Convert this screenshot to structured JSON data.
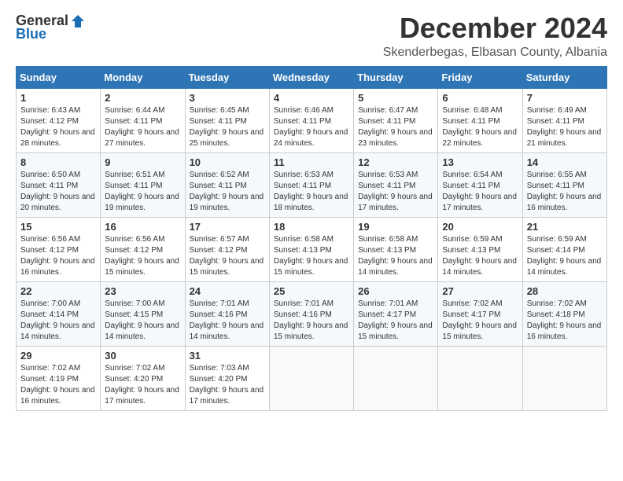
{
  "header": {
    "logo_general": "General",
    "logo_blue": "Blue",
    "title": "December 2024",
    "subtitle": "Skenderbegas, Elbasan County, Albania"
  },
  "days_of_week": [
    "Sunday",
    "Monday",
    "Tuesday",
    "Wednesday",
    "Thursday",
    "Friday",
    "Saturday"
  ],
  "weeks": [
    [
      {
        "day": "1",
        "sunrise": "6:43 AM",
        "sunset": "4:12 PM",
        "daylight": "9 hours and 28 minutes."
      },
      {
        "day": "2",
        "sunrise": "6:44 AM",
        "sunset": "4:11 PM",
        "daylight": "9 hours and 27 minutes."
      },
      {
        "day": "3",
        "sunrise": "6:45 AM",
        "sunset": "4:11 PM",
        "daylight": "9 hours and 25 minutes."
      },
      {
        "day": "4",
        "sunrise": "6:46 AM",
        "sunset": "4:11 PM",
        "daylight": "9 hours and 24 minutes."
      },
      {
        "day": "5",
        "sunrise": "6:47 AM",
        "sunset": "4:11 PM",
        "daylight": "9 hours and 23 minutes."
      },
      {
        "day": "6",
        "sunrise": "6:48 AM",
        "sunset": "4:11 PM",
        "daylight": "9 hours and 22 minutes."
      },
      {
        "day": "7",
        "sunrise": "6:49 AM",
        "sunset": "4:11 PM",
        "daylight": "9 hours and 21 minutes."
      }
    ],
    [
      {
        "day": "8",
        "sunrise": "6:50 AM",
        "sunset": "4:11 PM",
        "daylight": "9 hours and 20 minutes."
      },
      {
        "day": "9",
        "sunrise": "6:51 AM",
        "sunset": "4:11 PM",
        "daylight": "9 hours and 19 minutes."
      },
      {
        "day": "10",
        "sunrise": "6:52 AM",
        "sunset": "4:11 PM",
        "daylight": "9 hours and 19 minutes."
      },
      {
        "day": "11",
        "sunrise": "6:53 AM",
        "sunset": "4:11 PM",
        "daylight": "9 hours and 18 minutes."
      },
      {
        "day": "12",
        "sunrise": "6:53 AM",
        "sunset": "4:11 PM",
        "daylight": "9 hours and 17 minutes."
      },
      {
        "day": "13",
        "sunrise": "6:54 AM",
        "sunset": "4:11 PM",
        "daylight": "9 hours and 17 minutes."
      },
      {
        "day": "14",
        "sunrise": "6:55 AM",
        "sunset": "4:11 PM",
        "daylight": "9 hours and 16 minutes."
      }
    ],
    [
      {
        "day": "15",
        "sunrise": "6:56 AM",
        "sunset": "4:12 PM",
        "daylight": "9 hours and 16 minutes."
      },
      {
        "day": "16",
        "sunrise": "6:56 AM",
        "sunset": "4:12 PM",
        "daylight": "9 hours and 15 minutes."
      },
      {
        "day": "17",
        "sunrise": "6:57 AM",
        "sunset": "4:12 PM",
        "daylight": "9 hours and 15 minutes."
      },
      {
        "day": "18",
        "sunrise": "6:58 AM",
        "sunset": "4:13 PM",
        "daylight": "9 hours and 15 minutes."
      },
      {
        "day": "19",
        "sunrise": "6:58 AM",
        "sunset": "4:13 PM",
        "daylight": "9 hours and 14 minutes."
      },
      {
        "day": "20",
        "sunrise": "6:59 AM",
        "sunset": "4:13 PM",
        "daylight": "9 hours and 14 minutes."
      },
      {
        "day": "21",
        "sunrise": "6:59 AM",
        "sunset": "4:14 PM",
        "daylight": "9 hours and 14 minutes."
      }
    ],
    [
      {
        "day": "22",
        "sunrise": "7:00 AM",
        "sunset": "4:14 PM",
        "daylight": "9 hours and 14 minutes."
      },
      {
        "day": "23",
        "sunrise": "7:00 AM",
        "sunset": "4:15 PM",
        "daylight": "9 hours and 14 minutes."
      },
      {
        "day": "24",
        "sunrise": "7:01 AM",
        "sunset": "4:16 PM",
        "daylight": "9 hours and 14 minutes."
      },
      {
        "day": "25",
        "sunrise": "7:01 AM",
        "sunset": "4:16 PM",
        "daylight": "9 hours and 15 minutes."
      },
      {
        "day": "26",
        "sunrise": "7:01 AM",
        "sunset": "4:17 PM",
        "daylight": "9 hours and 15 minutes."
      },
      {
        "day": "27",
        "sunrise": "7:02 AM",
        "sunset": "4:17 PM",
        "daylight": "9 hours and 15 minutes."
      },
      {
        "day": "28",
        "sunrise": "7:02 AM",
        "sunset": "4:18 PM",
        "daylight": "9 hours and 16 minutes."
      }
    ],
    [
      {
        "day": "29",
        "sunrise": "7:02 AM",
        "sunset": "4:19 PM",
        "daylight": "9 hours and 16 minutes."
      },
      {
        "day": "30",
        "sunrise": "7:02 AM",
        "sunset": "4:20 PM",
        "daylight": "9 hours and 17 minutes."
      },
      {
        "day": "31",
        "sunrise": "7:03 AM",
        "sunset": "4:20 PM",
        "daylight": "9 hours and 17 minutes."
      },
      null,
      null,
      null,
      null
    ]
  ]
}
